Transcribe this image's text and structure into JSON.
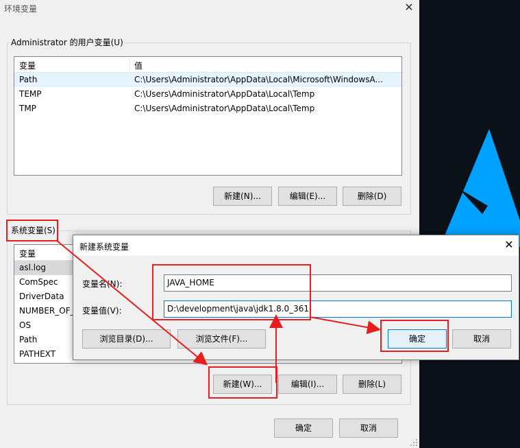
{
  "main_window": {
    "title": "环境变量",
    "close_glyph": "✕",
    "user_vars": {
      "legend": "Administrator 的用户变量(U)",
      "col_name": "变量",
      "col_value": "值",
      "rows": [
        {
          "name": "Path",
          "value": "C:\\Users\\Administrator\\AppData\\Local\\Microsoft\\WindowsA..."
        },
        {
          "name": "TEMP",
          "value": "C:\\Users\\Administrator\\AppData\\Local\\Temp"
        },
        {
          "name": "TMP",
          "value": "C:\\Users\\Administrator\\AppData\\Local\\Temp"
        }
      ],
      "new_label": "新建(N)...",
      "edit_label": "编辑(E)...",
      "delete_label": "删除(D)"
    },
    "sys_vars": {
      "legend": "系统变量(S)",
      "col_name": "变量",
      "rows": [
        {
          "name": "asl.log"
        },
        {
          "name": "ComSpec"
        },
        {
          "name": "DriverData"
        },
        {
          "name": "NUMBER_OF_"
        },
        {
          "name": "OS"
        },
        {
          "name": "Path"
        },
        {
          "name": "PATHEXT"
        }
      ],
      "new_label": "新建(W)...",
      "edit_label": "编辑(I)...",
      "delete_label": "删除(L)"
    },
    "ok_label": "确定",
    "cancel_label": "取消"
  },
  "dialog": {
    "title": "新建系统变量",
    "close_glyph": "✕",
    "name_label": "变量名(N):",
    "name_value": "JAVA_HOME",
    "value_label": "变量值(V):",
    "value_value": "D:\\development\\java\\jdk1.8.0_361",
    "browse_dir_label": "浏览目录(D)...",
    "browse_file_label": "浏览文件(F)...",
    "ok_label": "确定",
    "cancel_label": "取消"
  },
  "colors": {
    "annotation_red": "#e81e1e",
    "accent_blue": "#0078d7",
    "desktop_blue": "#00a2ff",
    "desktop_dark": "#0b1118"
  }
}
